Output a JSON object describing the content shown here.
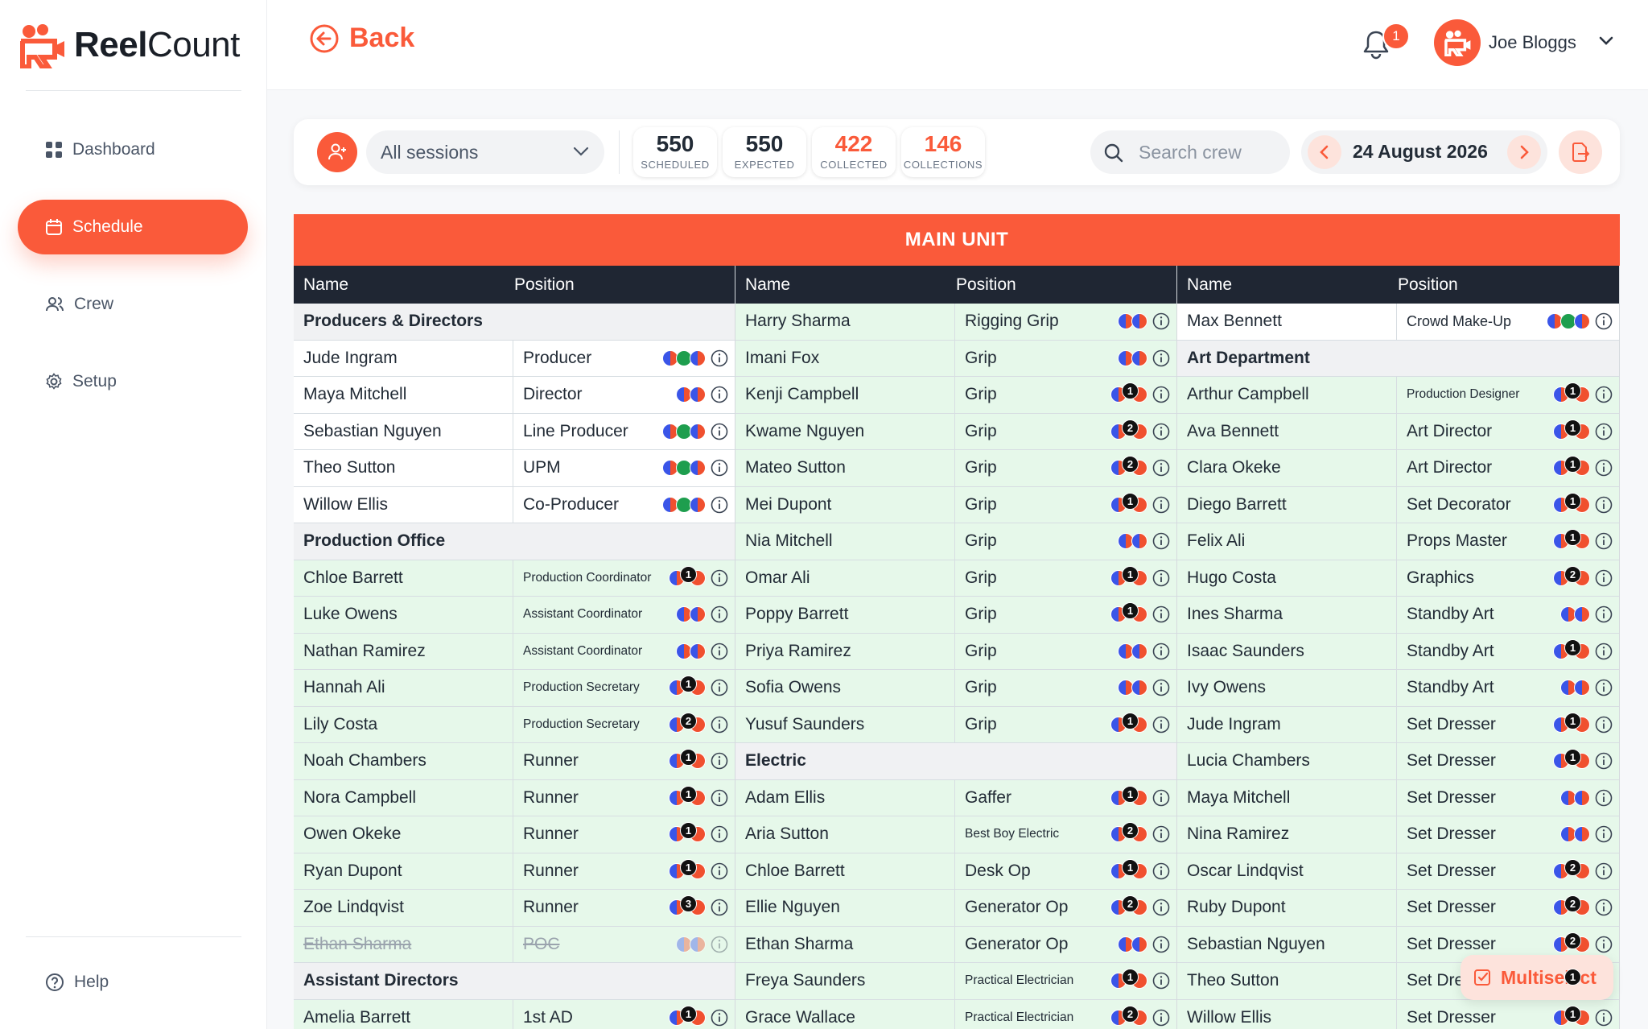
{
  "app": {
    "name_bold": "Reel",
    "name_thin": "Count"
  },
  "nav": {
    "dashboard": "Dashboard",
    "schedule": "Schedule",
    "crew": "Crew",
    "setup": "Setup",
    "help": "Help"
  },
  "header": {
    "back_label": "Back",
    "notification_count": "1",
    "user_name": "Joe Bloggs"
  },
  "toolbar": {
    "session_value": "All sessions",
    "stats": [
      {
        "value": "550",
        "label": "SCHEDULED"
      },
      {
        "value": "550",
        "label": "EXPECTED"
      },
      {
        "value": "422",
        "label": "COLLECTED"
      },
      {
        "value": "146",
        "label": "COLLECTIONS"
      }
    ],
    "search_placeholder": "Search crew",
    "date": "24 August 2026"
  },
  "unit_title": "MAIN UNIT",
  "columns_header": {
    "name": "Name",
    "position": "Position"
  },
  "columns": [
    {
      "rows": [
        {
          "type": "section",
          "label": "Producers & Directors"
        },
        {
          "name": "Jude Ingram",
          "position": "Producer",
          "icons": "bo,g,bo",
          "bg": "white"
        },
        {
          "name": "Maya Mitchell",
          "position": "Director",
          "icons": "bo,bo",
          "bg": "white"
        },
        {
          "name": "Sebastian Nguyen",
          "position": "Line Producer",
          "icons": "bo,g,bo",
          "bg": "white"
        },
        {
          "name": "Theo Sutton",
          "position": "UPM",
          "icons": "bo,g,bo",
          "bg": "white"
        },
        {
          "name": "Willow Ellis",
          "position": "Co-Producer",
          "icons": "bo,g,bo",
          "bg": "white"
        },
        {
          "type": "section",
          "label": "Production Office"
        },
        {
          "name": "Chloe Barrett",
          "position": "Production Coordinator",
          "small": true,
          "icons": "bo,1,r",
          "bg": "green"
        },
        {
          "name": "Luke Owens",
          "position": "Assistant Coordinator",
          "small": true,
          "icons": "bo,bo",
          "bg": "green"
        },
        {
          "name": "Nathan Ramirez",
          "position": "Assistant Coordinator",
          "small": true,
          "icons": "bo,bo",
          "bg": "green"
        },
        {
          "name": "Hannah Ali",
          "position": "Production Secretary",
          "small": true,
          "icons": "bo,1,r",
          "bg": "green"
        },
        {
          "name": "Lily Costa",
          "position": "Production Secretary",
          "small": true,
          "icons": "bo,2,r",
          "bg": "green"
        },
        {
          "name": "Noah Chambers",
          "position": "Runner",
          "icons": "bo,1,r",
          "bg": "green"
        },
        {
          "name": "Nora Campbell",
          "position": "Runner",
          "icons": "bo,1,r",
          "bg": "green"
        },
        {
          "name": "Owen Okeke",
          "position": "Runner",
          "icons": "bo,1,r",
          "bg": "green"
        },
        {
          "name": "Ryan Dupont",
          "position": "Runner",
          "icons": "bo,1,r",
          "bg": "green"
        },
        {
          "name": "Zoe Lindqvist",
          "position": "Runner",
          "icons": "bo,3,r",
          "bg": "green"
        },
        {
          "name": "Ethan Sharma",
          "position": "POC",
          "icons": "bo,bo",
          "bg": "green",
          "struck": true
        },
        {
          "type": "section",
          "label": "Assistant Directors"
        },
        {
          "name": "Amelia Barrett",
          "position": "1st AD",
          "icons": "bo,1,r",
          "bg": "green"
        }
      ]
    },
    {
      "rows": [
        {
          "name": "Harry Sharma",
          "position": "Rigging Grip",
          "icons": "bo,bo",
          "bg": "green"
        },
        {
          "name": "Imani Fox",
          "position": "Grip",
          "icons": "bo,bo",
          "bg": "green"
        },
        {
          "name": "Kenji Campbell",
          "position": "Grip",
          "icons": "bo,1,r",
          "bg": "green"
        },
        {
          "name": "Kwame Nguyen",
          "position": "Grip",
          "icons": "bo,2,r",
          "bg": "green"
        },
        {
          "name": "Mateo Sutton",
          "position": "Grip",
          "icons": "bo,2,r",
          "bg": "green"
        },
        {
          "name": "Mei Dupont",
          "position": "Grip",
          "icons": "bo,1,r",
          "bg": "green"
        },
        {
          "name": "Nia Mitchell",
          "position": "Grip",
          "icons": "bo,bo",
          "bg": "green"
        },
        {
          "name": "Omar Ali",
          "position": "Grip",
          "icons": "bo,1,r",
          "bg": "green"
        },
        {
          "name": "Poppy Barrett",
          "position": "Grip",
          "icons": "bo,1,r",
          "bg": "green"
        },
        {
          "name": "Priya Ramirez",
          "position": "Grip",
          "icons": "bo,bo",
          "bg": "green"
        },
        {
          "name": "Sofia Owens",
          "position": "Grip",
          "icons": "bo,bo",
          "bg": "green"
        },
        {
          "name": "Yusuf Saunders",
          "position": "Grip",
          "icons": "bo,1,r",
          "bg": "green"
        },
        {
          "type": "section",
          "label": "Electric"
        },
        {
          "name": "Adam Ellis",
          "position": "Gaffer",
          "icons": "bo,1,r",
          "bg": "green"
        },
        {
          "name": "Aria Sutton",
          "position": "Best Boy Electric",
          "small": true,
          "icons": "bo,2,r",
          "bg": "green"
        },
        {
          "name": "Chloe Barrett",
          "position": "Desk Op",
          "icons": "bo,1,r",
          "bg": "green"
        },
        {
          "name": "Ellie Nguyen",
          "position": "Generator Op",
          "icons": "bo,2,r",
          "bg": "green"
        },
        {
          "name": "Ethan Sharma",
          "position": "Generator Op",
          "icons": "bo,bo",
          "bg": "green"
        },
        {
          "name": "Freya Saunders",
          "position": "Practical Electrician",
          "small": true,
          "icons": "bo,1,r",
          "bg": "green"
        },
        {
          "name": "Grace Wallace",
          "position": "Practical Electrician",
          "small": true,
          "icons": "bo,2,r",
          "bg": "green"
        }
      ]
    },
    {
      "rows": [
        {
          "name": "Max Bennett",
          "position": "Crowd Make-Up",
          "small_one": true,
          "icons": "bo,g,bo",
          "bg": "white"
        },
        {
          "type": "section",
          "label": "Art Department"
        },
        {
          "name": "Arthur Campbell",
          "position": "Production Designer",
          "small": true,
          "icons": "bo,1,r",
          "bg": "green"
        },
        {
          "name": "Ava Bennett",
          "position": "Art Director",
          "icons": "bo,1,r",
          "bg": "green"
        },
        {
          "name": "Clara Okeke",
          "position": "Art Director",
          "icons": "bo,1,r",
          "bg": "green"
        },
        {
          "name": "Diego Barrett",
          "position": "Set Decorator",
          "icons": "bo,1,r",
          "bg": "green"
        },
        {
          "name": "Felix Ali",
          "position": "Props Master",
          "icons": "bo,1,r",
          "bg": "green"
        },
        {
          "name": "Hugo Costa",
          "position": "Graphics",
          "icons": "bo,2,r",
          "bg": "green"
        },
        {
          "name": "Ines Sharma",
          "position": "Standby Art",
          "icons": "bo,bo",
          "bg": "green"
        },
        {
          "name": "Isaac Saunders",
          "position": "Standby Art",
          "icons": "bo,1,r",
          "bg": "green"
        },
        {
          "name": "Ivy Owens",
          "position": "Standby Art",
          "icons": "bo,bo",
          "bg": "green"
        },
        {
          "name": "Jude Ingram",
          "position": "Set Dresser",
          "icons": "bo,1,r",
          "bg": "green"
        },
        {
          "name": "Lucia Chambers",
          "position": "Set Dresser",
          "icons": "bo,1,r",
          "bg": "green"
        },
        {
          "name": "Maya Mitchell",
          "position": "Set Dresser",
          "icons": "bo,bo",
          "bg": "green"
        },
        {
          "name": "Nina Ramirez",
          "position": "Set Dresser",
          "icons": "bo,bo",
          "bg": "green"
        },
        {
          "name": "Oscar Lindqvist",
          "position": "Set Dresser",
          "icons": "bo,2,r",
          "bg": "green"
        },
        {
          "name": "Ruby Dupont",
          "position": "Set Dresser",
          "icons": "bo,2,r",
          "bg": "green"
        },
        {
          "name": "Sebastian Nguyen",
          "position": "Set Dresser",
          "icons": "bo,2,r",
          "bg": "green"
        },
        {
          "name": "Theo Sutton",
          "position": "Set Dresser",
          "icons": "bo,1,r",
          "bg": "green"
        },
        {
          "name": "Willow Ellis",
          "position": "Set Dresser",
          "icons": "bo,1,r",
          "bg": "green"
        }
      ]
    }
  ],
  "multiselect_label": "Multiselect",
  "colors": {
    "accent": "#fa5a3a",
    "row_green": "#e6f8ea",
    "header_dark": "#1f2633"
  }
}
